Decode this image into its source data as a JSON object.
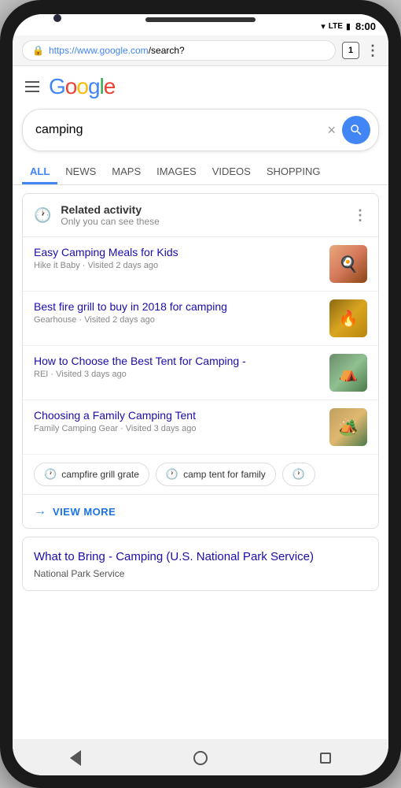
{
  "phone": {
    "time": "8:00",
    "camera": true
  },
  "browser": {
    "url_prefix": "https://www.google.com",
    "url_suffix": "/search?",
    "tab_count": "1"
  },
  "google": {
    "logo_letters": [
      {
        "char": "G",
        "color": "blue"
      },
      {
        "char": "o",
        "color": "red"
      },
      {
        "char": "o",
        "color": "yellow"
      },
      {
        "char": "g",
        "color": "blue"
      },
      {
        "char": "l",
        "color": "green"
      },
      {
        "char": "e",
        "color": "red"
      }
    ]
  },
  "search": {
    "query": "camping",
    "clear_label": "×",
    "button_aria": "Search"
  },
  "tabs": [
    {
      "id": "all",
      "label": "ALL",
      "active": true
    },
    {
      "id": "news",
      "label": "NEWS",
      "active": false
    },
    {
      "id": "maps",
      "label": "MAPS",
      "active": false
    },
    {
      "id": "images",
      "label": "IMAGES",
      "active": false
    },
    {
      "id": "videos",
      "label": "VIDEOS",
      "active": false
    },
    {
      "id": "shopping",
      "label": "SHOPPING",
      "active": false
    }
  ],
  "related_activity": {
    "title": "Related activity",
    "subtitle": "Only you can see these",
    "more_label": "⋮"
  },
  "results": [
    {
      "title": "Easy Camping Meals for Kids",
      "source": "Hike it Baby",
      "meta": "Visited 2 days ago",
      "thumb_type": "meals"
    },
    {
      "title": "Best fire grill to buy in 2018 for camping",
      "source": "Gearhouse",
      "meta": "Visited 2 days ago",
      "thumb_type": "grill"
    },
    {
      "title": "How to Choose the Best Tent for Camping -",
      "source": "REI",
      "meta": "Visited 3 days ago",
      "thumb_type": "tent"
    },
    {
      "title": "Choosing a Family Camping Tent",
      "source": "Family Camping Gear",
      "meta": "Visited 3 days ago",
      "thumb_type": "family"
    }
  ],
  "chips": [
    {
      "label": "campfire grill grate",
      "has_clock": true
    },
    {
      "label": "camp tent for family",
      "has_clock": true
    },
    {
      "label": "",
      "has_clock": true
    }
  ],
  "view_more": {
    "label": "VIEW MORE"
  },
  "second_result": {
    "title": "What to Bring - Camping (U.S. National Park Service)",
    "source": "National Park Service"
  }
}
